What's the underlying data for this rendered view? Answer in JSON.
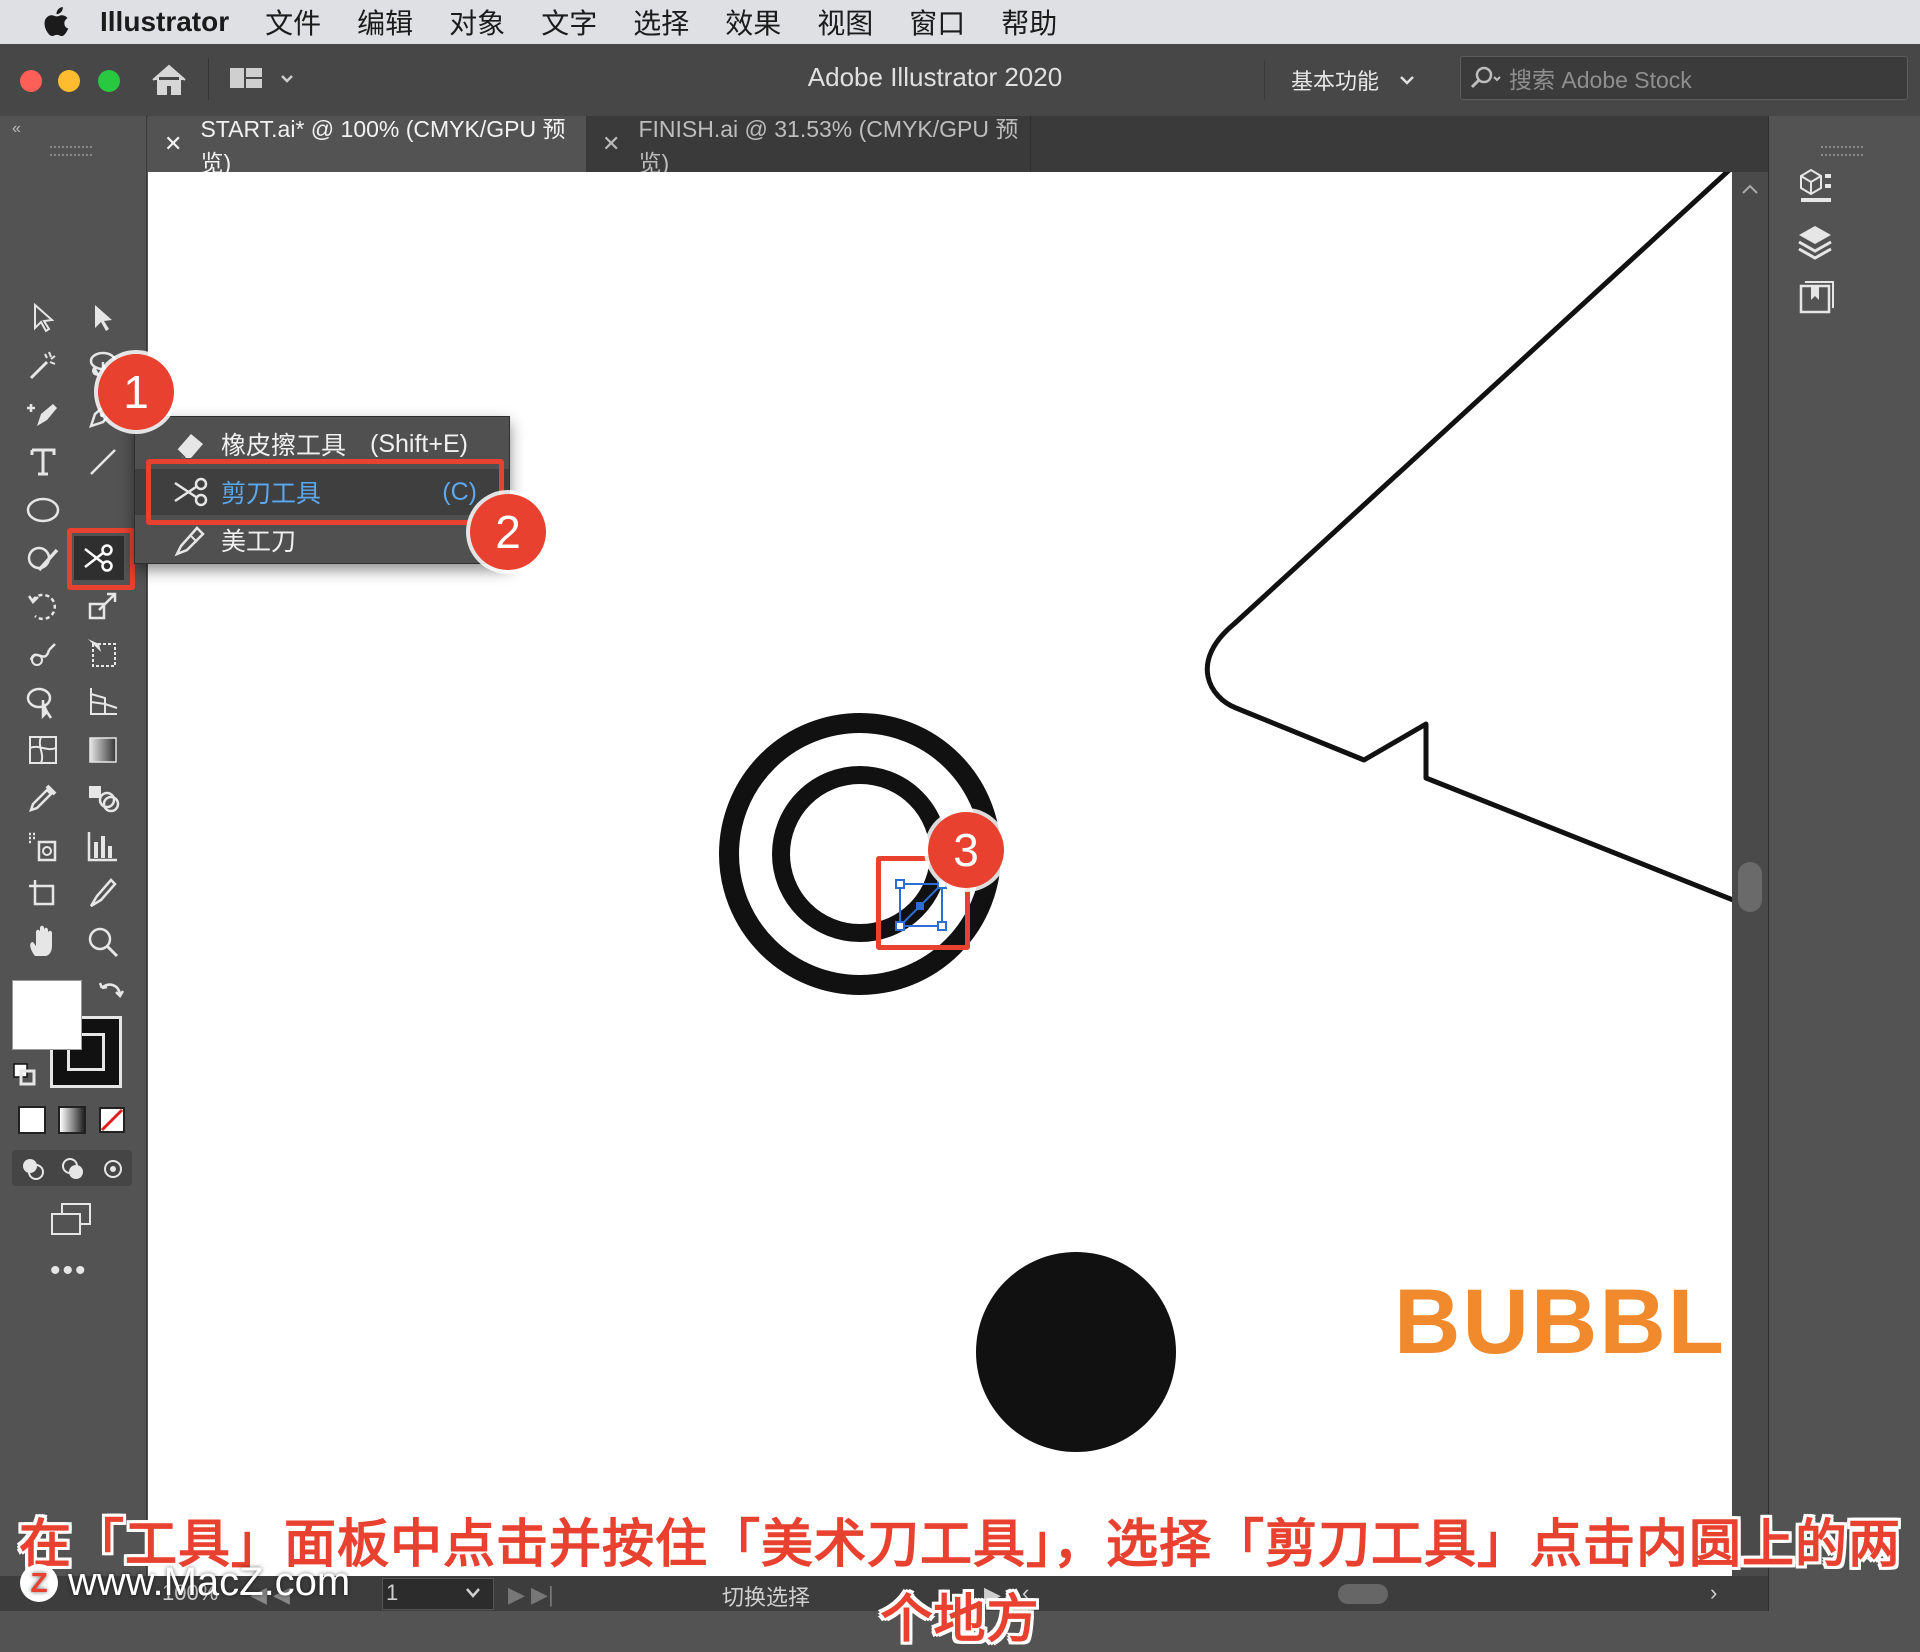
{
  "menubar": {
    "app_name": "Illustrator",
    "items": [
      "文件",
      "编辑",
      "对象",
      "文字",
      "选择",
      "效果",
      "视图",
      "窗口",
      "帮助"
    ]
  },
  "titlebar": {
    "title": "Adobe Illustrator 2020",
    "workspace": "基本功能",
    "stock_placeholder": "搜索 Adobe Stock"
  },
  "tabs": [
    {
      "label": "START.ai* @ 100% (CMYK/GPU 预览)",
      "active": true
    },
    {
      "label": "FINISH.ai @ 31.53% (CMYK/GPU 预览)",
      "active": false
    }
  ],
  "flyout": {
    "items": [
      {
        "label": "橡皮擦工具",
        "shortcut": "(Shift+E)",
        "icon": "eraser-icon"
      },
      {
        "label": "剪刀工具",
        "shortcut": "(C)",
        "icon": "scissors-icon",
        "highlighted": true
      },
      {
        "label": "美工刀",
        "shortcut": "",
        "icon": "knife-icon"
      }
    ]
  },
  "badges": [
    "1",
    "2",
    "3"
  ],
  "canvas": {
    "bubble_text": "BUBBLE"
  },
  "statusbar": {
    "zoom": "100%",
    "page": "1",
    "info": "切换选择"
  },
  "caption": "在「工具」面板中点击并按住「美术刀工具」，选择「剪刀工具」点击内圆上的两个地方",
  "watermark": "www.MacZ.com",
  "colors": {
    "accent_red": "#e8412f",
    "highlight_blue": "#5aa8f0",
    "bubble_orange": "#f08a2c"
  }
}
